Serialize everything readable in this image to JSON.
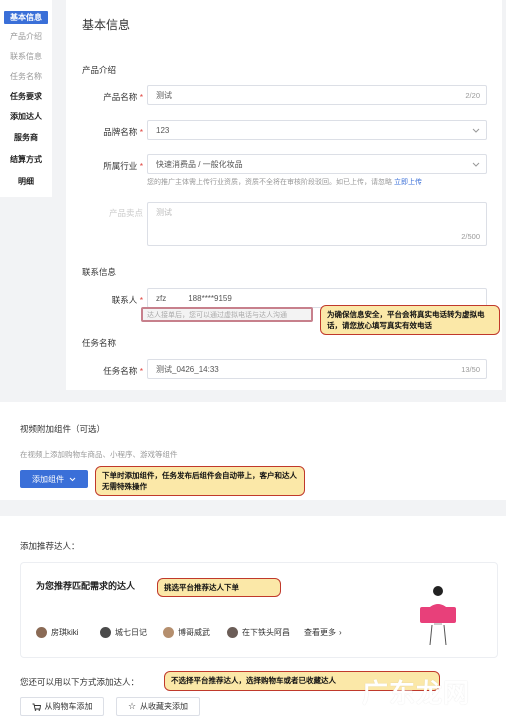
{
  "sidebar": {
    "items": [
      {
        "label": "基本信息"
      },
      {
        "label": "产品介绍"
      },
      {
        "label": "联系信息"
      },
      {
        "label": "任务名称"
      },
      {
        "label": "任务要求"
      },
      {
        "label": "添加达人"
      },
      {
        "label": "服务商"
      },
      {
        "label": "结算方式"
      },
      {
        "label": "明细"
      }
    ]
  },
  "main": {
    "title": "基本信息",
    "product_section": "产品介绍",
    "product_name": {
      "label": "产品名称",
      "value": "测试",
      "count": "2/20"
    },
    "brand_name": {
      "label": "品牌名称",
      "value": "123"
    },
    "industry": {
      "label": "所属行业",
      "value": "快速消费品 / 一般化妆品",
      "hint": "您的推广主体需上传行业资质，资质不全将在审核阶段驳回。如已上传，请忽略",
      "hint_link": "立即上传"
    },
    "selling_point": {
      "label": "产品卖点",
      "value": "测试",
      "count": "2/500"
    },
    "contact_section": "联系信息",
    "contact": {
      "label": "联系人",
      "name": "zfz",
      "phone": "188****9159",
      "hint": "达人接单后，您可以通过虚拟电话与达人沟通"
    },
    "contact_callout": "为确保信息安全，平台会将真实电话转为虚拟电话，请您放心填写真实有效电话",
    "task_section": "任务名称",
    "task_name": {
      "label": "任务名称",
      "value": "测试_0426_14:33",
      "count": "13/50"
    }
  },
  "video": {
    "title": "视频附加组件（可选）",
    "desc": "在视频上添加购物车商品、小程序、游戏等组件",
    "add_button": "添加组件",
    "callout": "下单时添加组件，任务发布后组件会自动带上，客户和达人无需特殊操作"
  },
  "talent": {
    "title": "添加推荐达人：",
    "rec_title": "为您推荐匹配需求的达人",
    "rec_callout": "挑选平台推荐达人下单",
    "creators": [
      "房琪kiki",
      "城七日记",
      "博哥威武",
      "在下铁头阿昌"
    ],
    "creator_colors": [
      "#8a6a55",
      "#4a4a4a",
      "#b58f6e",
      "#6b5d57"
    ],
    "see_more": "查看更多",
    "other_methods": "您还可以用以下方式添加达人：",
    "other_callout": "不选择平台推荐达人，选择购物车或者已收藏达人",
    "cart_button": "从购物车添加",
    "fav_button": "从收藏夹添加"
  },
  "watermark": "广东龙网",
  "colors": {
    "accent": "#3a6fd8",
    "required": "#e0413b",
    "callout_bg": "#fbe8a8",
    "callout_border": "#c0392b"
  }
}
